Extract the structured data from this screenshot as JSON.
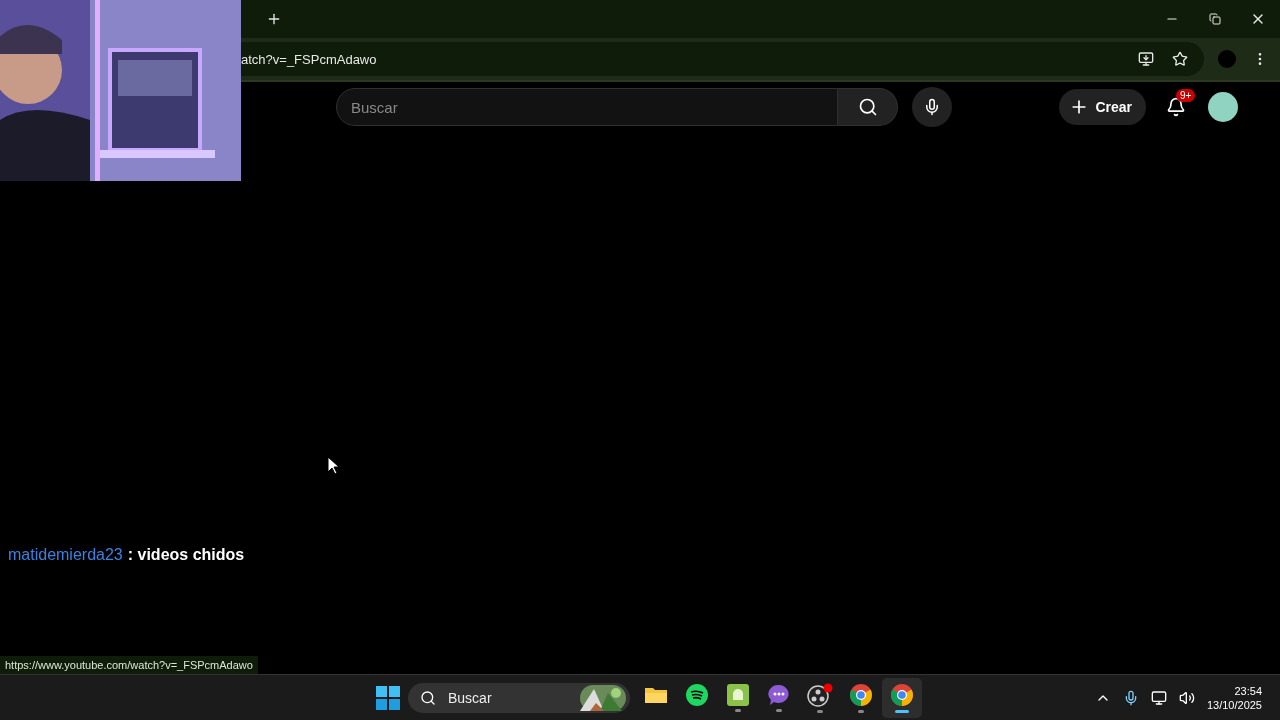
{
  "browser": {
    "address": "atch?v=_FSPcmAdawo",
    "status_url": "https://www.youtube.com/watch?v=_FSPcmAdawo"
  },
  "youtube": {
    "search": {
      "placeholder": "Buscar"
    },
    "create_label": "Crear",
    "notification_badge": "9+"
  },
  "chat": {
    "user": "matidemierda23",
    "message": ": videos chidos"
  },
  "taskbar": {
    "search": {
      "placeholder": "Buscar"
    },
    "apps": [
      {
        "kind": "files",
        "running": false,
        "selected": false
      },
      {
        "kind": "spotify",
        "running": false,
        "selected": false
      },
      {
        "kind": "android",
        "running": true,
        "selected": false
      },
      {
        "kind": "chat",
        "running": true,
        "selected": false
      },
      {
        "kind": "obs",
        "running": true,
        "selected": false
      },
      {
        "kind": "chrome",
        "running": true,
        "selected": false
      },
      {
        "kind": "chrome",
        "running": true,
        "selected": true
      }
    ],
    "time": "23:54",
    "date": "13/10/2025"
  }
}
